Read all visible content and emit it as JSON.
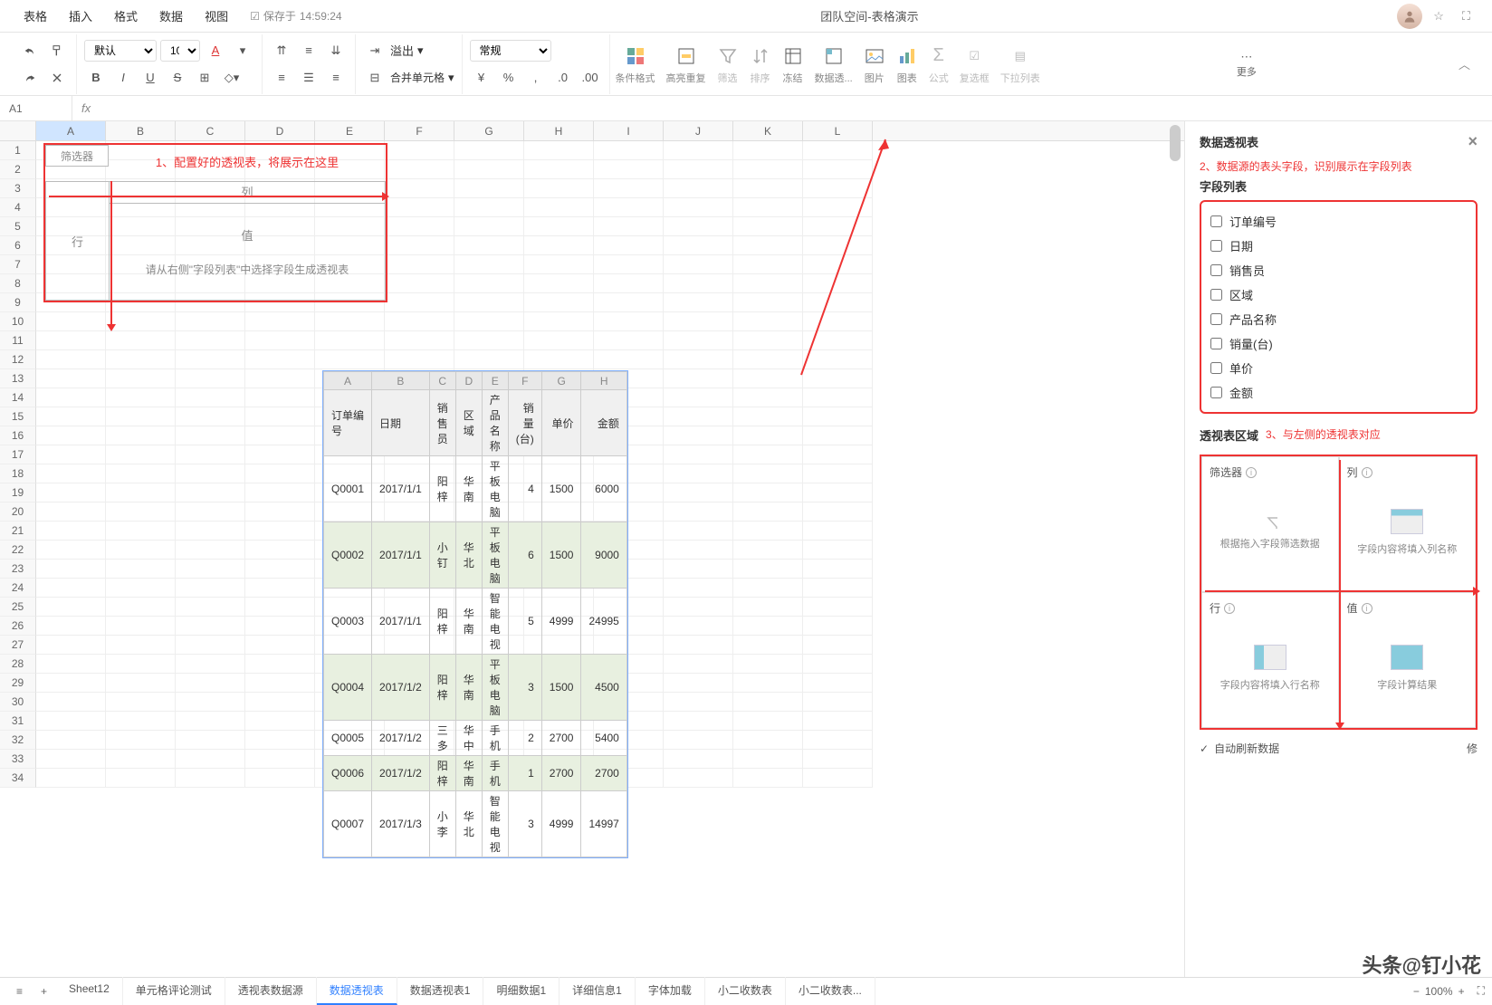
{
  "menubar": {
    "items": [
      "表格",
      "插入",
      "格式",
      "数据",
      "视图"
    ],
    "saved_prefix": "保存于",
    "saved_time": "14:59:24",
    "title": "团队空间-表格演示"
  },
  "toolbar": {
    "font_family": "默认",
    "font_size": "10",
    "number_format": "常规",
    "overflow_label": "溢出",
    "merge_label": "合并单元格",
    "cond_format": "条件格式",
    "highlight_dup": "高亮重复",
    "filter": "筛选",
    "sort": "排序",
    "freeze": "冻结",
    "pivot": "数据透...",
    "image": "图片",
    "chart": "图表",
    "formula": "公式",
    "rewire": "复选框",
    "dropdown_col": "下拉列表",
    "more": "更多"
  },
  "formula_bar": {
    "cell_ref": "A1",
    "fx": "fx"
  },
  "grid": {
    "col_headers": [
      "A",
      "B",
      "C",
      "D",
      "E",
      "F",
      "G",
      "H",
      "I",
      "J",
      "K",
      "L"
    ]
  },
  "pivot_ph": {
    "filter": "筛选器",
    "note1": "1、配置好的透视表，将展示在这里",
    "col_label": "列",
    "row_label": "行",
    "value_label": "值",
    "hint": "请从右侧\"字段列表\"中选择字段生成透视表"
  },
  "data_table": {
    "col_letters": [
      "A",
      "B",
      "C",
      "D",
      "E",
      "F",
      "G",
      "H"
    ],
    "headers": [
      "订单编号",
      "日期",
      "销售员",
      "区域",
      "产品名称",
      "销量(台)",
      "单价",
      "金额"
    ],
    "rows": [
      [
        "Q0001",
        "2017/1/1",
        "阳梓",
        "华南",
        "平板电脑",
        "4",
        "1500",
        "6000"
      ],
      [
        "Q0002",
        "2017/1/1",
        "小钉",
        "华北",
        "平板电脑",
        "6",
        "1500",
        "9000"
      ],
      [
        "Q0003",
        "2017/1/1",
        "阳梓",
        "华南",
        "智能电视",
        "5",
        "4999",
        "24995"
      ],
      [
        "Q0004",
        "2017/1/2",
        "阳梓",
        "华南",
        "平板电脑",
        "3",
        "1500",
        "4500"
      ],
      [
        "Q0005",
        "2017/1/2",
        "三多",
        "华中",
        "手机",
        "2",
        "2700",
        "5400"
      ],
      [
        "Q0006",
        "2017/1/2",
        "阳梓",
        "华南",
        "手机",
        "1",
        "2700",
        "2700"
      ],
      [
        "Q0007",
        "2017/1/3",
        "小李",
        "华北",
        "智能电视",
        "3",
        "4999",
        "14997"
      ]
    ]
  },
  "panel": {
    "title": "数据透视表",
    "note2": "2、数据源的表头字段，识别展示在字段列表",
    "field_list_title": "字段列表",
    "fields": [
      "订单编号",
      "日期",
      "销售员",
      "区域",
      "产品名称",
      "销量(台)",
      "单价",
      "金额"
    ],
    "areas_title": "透视表区域",
    "note3": "3、与左侧的透视表对应",
    "areas": {
      "filter": {
        "title": "筛选器",
        "hint": "根据拖入字段筛选数据"
      },
      "cols": {
        "title": "列",
        "hint": "字段内容将填入列名称"
      },
      "rows": {
        "title": "行",
        "hint": "字段内容将填入行名称"
      },
      "values": {
        "title": "值",
        "hint": "字段计算结果"
      }
    },
    "auto_refresh": "自动刷新数据",
    "edit": "修"
  },
  "tabs": {
    "sheets": [
      "Sheet12",
      "单元格评论测试",
      "透视表数据源",
      "数据透视表",
      "数据透视表1",
      "明细数据1",
      "详细信息1",
      "字体加载",
      "小二收数表",
      "小二收数表..."
    ],
    "active_index": 3,
    "zoom": "100%"
  },
  "watermark": "头条@钉小花"
}
